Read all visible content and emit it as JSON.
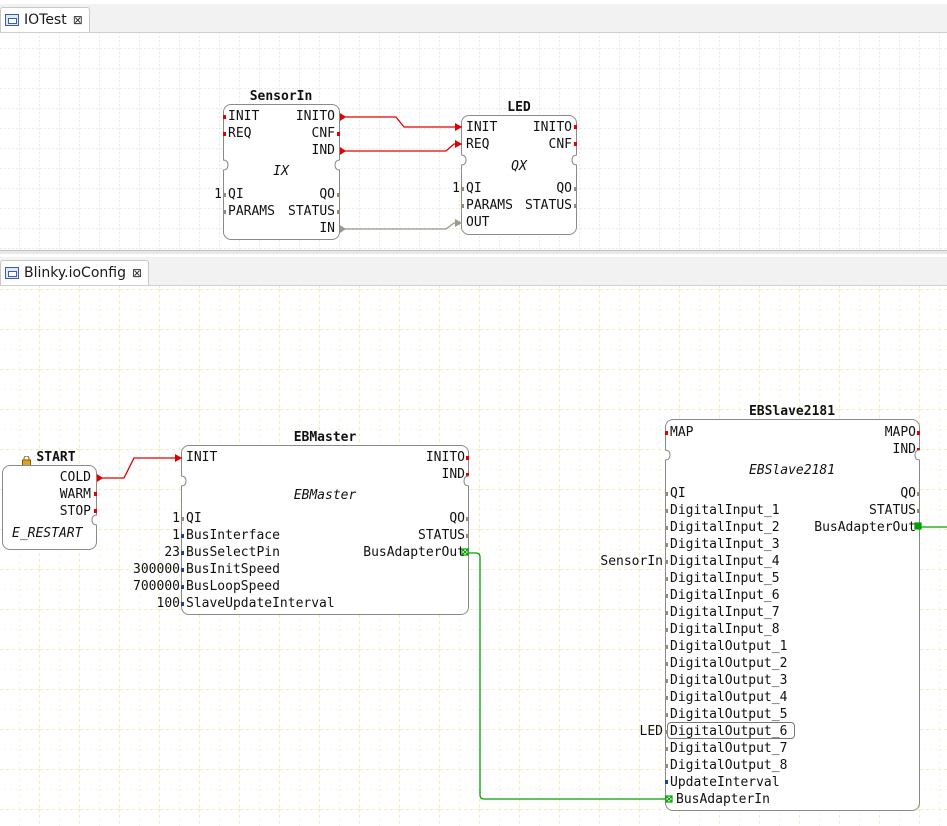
{
  "top_tab": {
    "label": "IOTest",
    "close": "⊠"
  },
  "bottom_tab": {
    "label": "Blinky.ioConfig",
    "close": "⊠"
  },
  "colors": {
    "event": "#e00000",
    "data_gray": "#9a9a8a",
    "adapter": "#00a000",
    "var": "#1f3fa0"
  },
  "sensorin": {
    "name": "SensorIn",
    "type": "IX",
    "ev_in": [
      "INIT",
      "REQ"
    ],
    "ev_out": [
      "INITO",
      "CNF",
      "IND"
    ],
    "qi_value": "1",
    "data_in": [
      "QI",
      "PARAMS"
    ],
    "data_out": [
      "QO",
      "STATUS",
      "IN"
    ]
  },
  "led": {
    "name": "LED",
    "type": "QX",
    "ev_in": [
      "INIT",
      "REQ"
    ],
    "ev_out": [
      "INITO",
      "CNF"
    ],
    "qi_value": "1",
    "data_in": [
      "QI",
      "PARAMS",
      "OUT"
    ],
    "data_out": [
      "QO",
      "STATUS"
    ]
  },
  "start": {
    "name": "START",
    "type": "E_RESTART",
    "ev_out": [
      "COLD",
      "WARM",
      "STOP"
    ]
  },
  "ebmaster": {
    "name": "EBMaster",
    "type": "EBMaster",
    "ev_in": [
      "INIT"
    ],
    "ev_out": [
      "INITO",
      "IND"
    ],
    "data_in": [
      "QI",
      "BusInterface",
      "BusSelectPin",
      "BusInitSpeed",
      "BusLoopSpeed",
      "SlaveUpdateInterval"
    ],
    "values": [
      "1",
      "1",
      "23",
      "300000",
      "700000",
      "100"
    ],
    "data_out": [
      "QO",
      "STATUS",
      "BusAdapterOut"
    ]
  },
  "ebslave": {
    "name": "EBSlave2181",
    "type": "EBSlave2181",
    "ev_in": [
      "MAP"
    ],
    "ev_out": [
      "MAPO",
      "IND"
    ],
    "data_in": [
      "QI",
      "DigitalInput_1",
      "DigitalInput_2",
      "DigitalInput_3",
      "DigitalInput_4",
      "DigitalInput_5",
      "DigitalInput_6",
      "DigitalInput_7",
      "DigitalInput_8",
      "DigitalOutput_1",
      "DigitalOutput_2",
      "DigitalOutput_3",
      "DigitalOutput_4",
      "DigitalOutput_5",
      "DigitalOutput_6",
      "DigitalOutput_7",
      "DigitalOutput_8",
      "UpdateInterval",
      "BusAdapterIn"
    ],
    "data_out": [
      "QO",
      "STATUS",
      "BusAdapterOut"
    ],
    "mapped_sensor": "SensorIn",
    "mapped_led": "LED"
  }
}
